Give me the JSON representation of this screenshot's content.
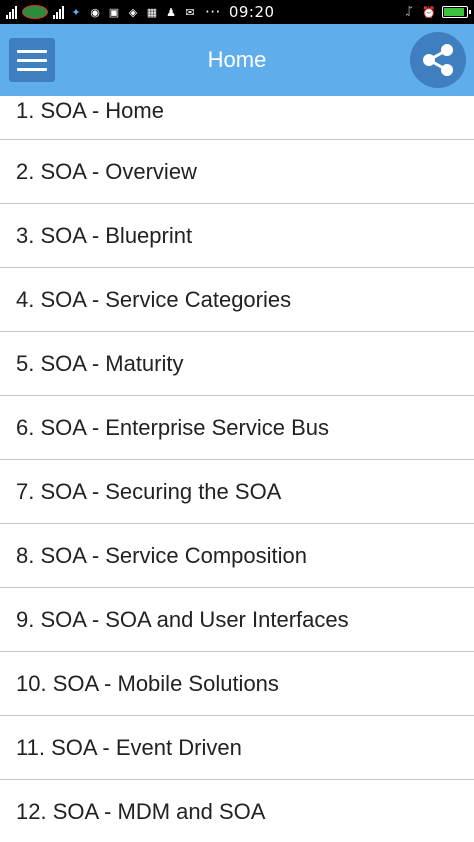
{
  "status_bar": {
    "time": "09:20",
    "ellipsis": "···"
  },
  "app_bar": {
    "title": "Home",
    "color": "#5fadeb",
    "button_color": "#3f7fc0"
  },
  "list": {
    "items": [
      {
        "label": "1. SOA - Home"
      },
      {
        "label": "2. SOA - Overview"
      },
      {
        "label": "3. SOA - Blueprint"
      },
      {
        "label": "4. SOA - Service Categories"
      },
      {
        "label": "5. SOA - Maturity"
      },
      {
        "label": "6. SOA - Enterprise Service Bus"
      },
      {
        "label": "7. SOA - Securing the SOA"
      },
      {
        "label": "8. SOA - Service Composition"
      },
      {
        "label": "9. SOA - SOA and User Interfaces"
      },
      {
        "label": "10. SOA - Mobile Solutions"
      },
      {
        "label": "11. SOA - Event Driven"
      },
      {
        "label": "12. SOA - MDM and SOA"
      }
    ]
  }
}
